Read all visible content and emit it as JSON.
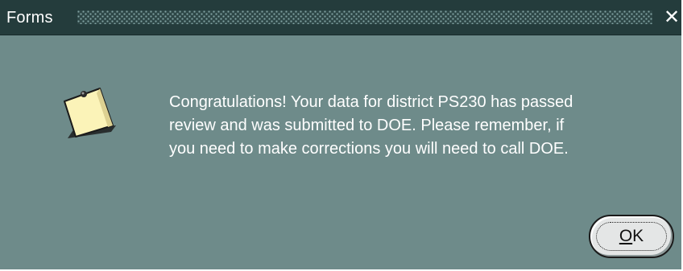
{
  "window": {
    "title": "Forms",
    "close_glyph": "✕"
  },
  "dialog": {
    "icon": "note-icon",
    "message": "Congratulations! Your data for district PS230 has passed\nreview and was submitted to DOE.  Please remember, if\nyou need to make corrections you will need to call DOE."
  },
  "buttons": {
    "ok_mnemonic": "O",
    "ok_rest": "K"
  },
  "colors": {
    "dialog_background": "#6e8b8a",
    "titlebar": "#243c3c",
    "text": "#ffffff",
    "note": "#fbf3b8"
  }
}
